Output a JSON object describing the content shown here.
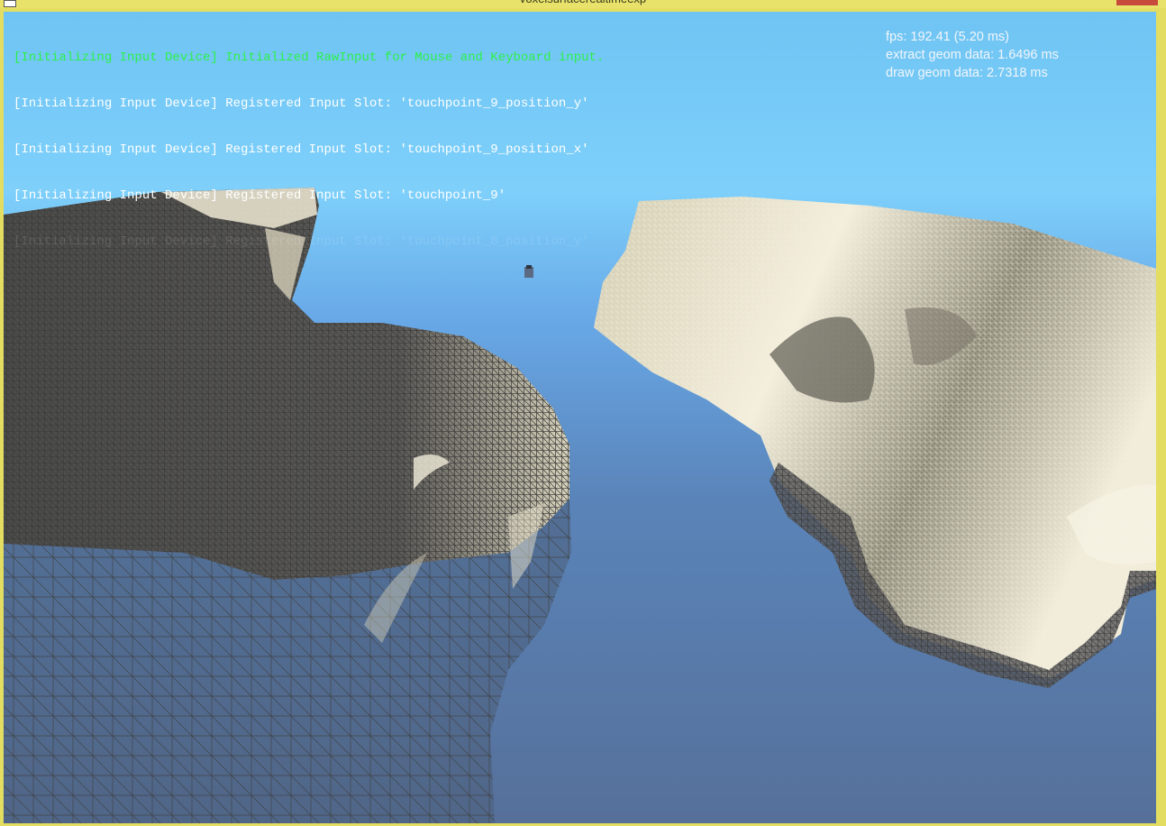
{
  "window": {
    "title": "voxelsurfacerealtimeexp"
  },
  "console": {
    "lines": [
      "[Initializing Input Device] Initialized RawInput for Mouse and Keyboard input.",
      "[Initializing Input Device] Registered Input Slot: 'touchpoint_9_position_y'",
      "[Initializing Input Device] Registered Input Slot: 'touchpoint_9_position_x'",
      "[Initializing Input Device] Registered Input Slot: 'touchpoint_9'",
      "[Initializing Input Device] Registered Input Slot: 'touchpoint_8_position_y'"
    ]
  },
  "stats": {
    "fps": "fps: 192.41 (5.20 ms)",
    "extract": "extract geom data: 1.6496 ms",
    "draw": "draw geom data: 2.7318 ms"
  },
  "colors": {
    "frame": "#e3dd62",
    "highlight_text": "#2cf04a",
    "sky_top": "#7ed0fb",
    "sky_bottom": "#56709a",
    "mesh_dark": "#4a4a48",
    "mesh_light": "#efe8cf"
  }
}
